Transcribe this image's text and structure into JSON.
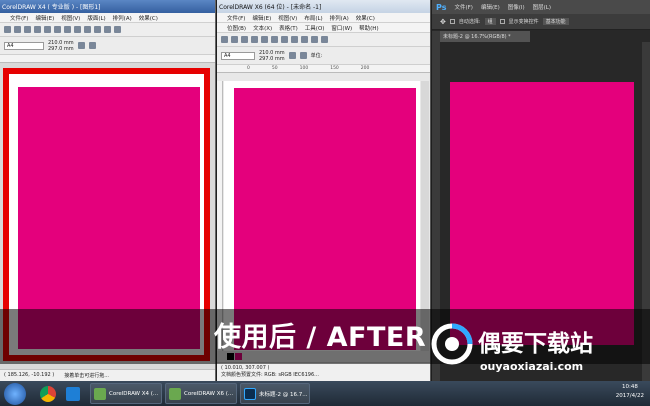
{
  "window1": {
    "title": "CorelDRAW X4 ( 专业版 ) - [图形1]",
    "menu": [
      "文件(F)",
      "编辑(E)",
      "视图(V)",
      "版面(L)",
      "排列(A)",
      "效果(C)"
    ],
    "paper_size": "A4",
    "width": "210.0 mm",
    "height": "297.0 mm",
    "coords": "( 185.126, -10.192 )",
    "status_text": "接着单击可进行拖..."
  },
  "window2": {
    "title": "CorelDRAW X6 (64 位) - [未命名 -1]",
    "menu": [
      "文件(F)",
      "编辑(E)",
      "视图(V)",
      "布局(L)",
      "排列(A)",
      "效果(C)"
    ],
    "menu_row2": [
      "位图(B)",
      "文本(X)",
      "表格(T)",
      "工具(O)",
      "窗口(W)",
      "帮助(H)"
    ],
    "paper_size": "A4",
    "width": "210.0 mm",
    "height": "297.0 mm",
    "units_label": "单位:",
    "ruler_ticks": [
      "0",
      "50",
      "100",
      "150",
      "200"
    ],
    "coords": "( 10.010, 307.007 )",
    "status_text": "文档颜色预置文件: RGB: sRGB IEC6196..."
  },
  "window3": {
    "logo": "Ps",
    "menu": [
      "文件(F)",
      "编辑(E)",
      "图像(I)",
      "图层(L)"
    ],
    "auto_select": "自动选择:",
    "auto_select_value": "组",
    "show_transform": "显示变换控件",
    "workspace": "基本功能",
    "doc_tab": "未标题-2 @ 16.7%(RGB/8) *"
  },
  "caption": "使用后 / AFTER",
  "watermark": {
    "text": "偶要下载站",
    "url": "ouyaoxiazai.com"
  },
  "taskbar": {
    "tasks": [
      "CorelDRAW X4 (...",
      "CorelDRAW X6 (...",
      "未标题-2 @ 16.7..."
    ],
    "time": "10:48",
    "date": "2017/4/22"
  },
  "colors": {
    "page_magenta": "#e4007c",
    "highlight_red": "#e60000",
    "ps_dark": "#3c3c3c"
  }
}
